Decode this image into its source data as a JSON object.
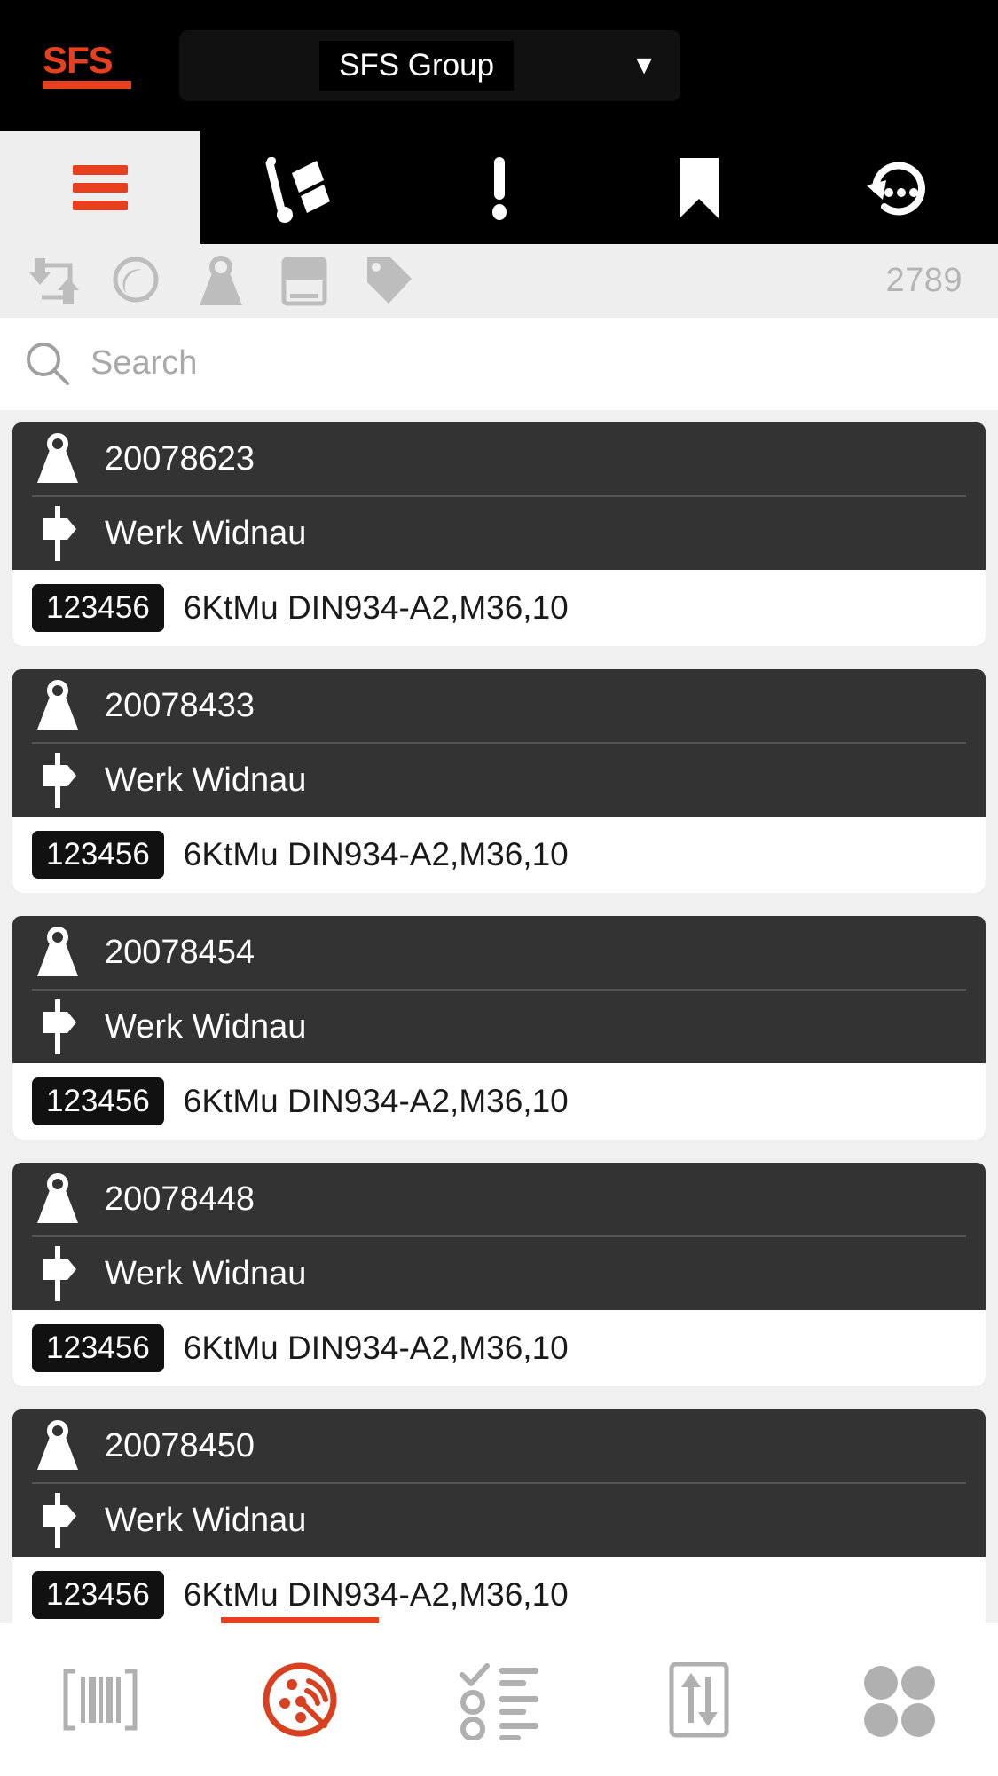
{
  "brand": {
    "logo_text": "SFS",
    "logo_name": "sfs-logo"
  },
  "org_selector": {
    "value": "SFS Group",
    "caret": "▼"
  },
  "tabs": [
    {
      "name": "menu",
      "icon": "hamburger-icon",
      "active": true
    },
    {
      "name": "delivery",
      "icon": "hand-truck-icon",
      "active": false
    },
    {
      "name": "alerts",
      "icon": "exclamation-icon",
      "active": false
    },
    {
      "name": "bookmarks",
      "icon": "bookmark-icon",
      "active": false
    },
    {
      "name": "history",
      "icon": "history-icon",
      "active": false
    }
  ],
  "filter_row": {
    "icons": [
      {
        "name": "transfer-icon"
      },
      {
        "name": "lifebuoy-icon"
      },
      {
        "name": "weight-icon"
      },
      {
        "name": "card-icon"
      },
      {
        "name": "tag-icon"
      }
    ],
    "count": "2789"
  },
  "search": {
    "placeholder": "Search",
    "value": "",
    "icon": "search-icon"
  },
  "list": {
    "icons": {
      "title": "weight-icon",
      "location": "signpost-icon"
    },
    "items": [
      {
        "id": "20078623",
        "location": "Werk Widnau",
        "chip": "123456",
        "description": "6KtMu DIN934-A2,M36,10"
      },
      {
        "id": "20078433",
        "location": "Werk Widnau",
        "chip": "123456",
        "description": "6KtMu DIN934-A2,M36,10"
      },
      {
        "id": "20078454",
        "location": "Werk Widnau",
        "chip": "123456",
        "description": "6KtMu DIN934-A2,M36,10"
      },
      {
        "id": "20078448",
        "location": "Werk Widnau",
        "chip": "123456",
        "description": "6KtMu DIN934-A2,M36,10"
      },
      {
        "id": "20078450",
        "location": "Werk Widnau",
        "chip": "123456",
        "description": "6KtMu DIN934-A2,M36,10"
      }
    ]
  },
  "bottom_nav": [
    {
      "name": "barcode-scan",
      "icon": "barcode-icon",
      "active": false
    },
    {
      "name": "rfid-scan",
      "icon": "rfid-icon",
      "active": true
    },
    {
      "name": "checklist",
      "icon": "checklist-icon",
      "active": false
    },
    {
      "name": "transfer",
      "icon": "up-down-arrows-icon",
      "active": false
    },
    {
      "name": "more",
      "icon": "grid-dots-icon",
      "active": false
    }
  ],
  "colors": {
    "accent": "#e8401f",
    "card": "#333333",
    "background": "#f0f0f0",
    "header": "#000000",
    "muted": "#b4b4b4"
  }
}
